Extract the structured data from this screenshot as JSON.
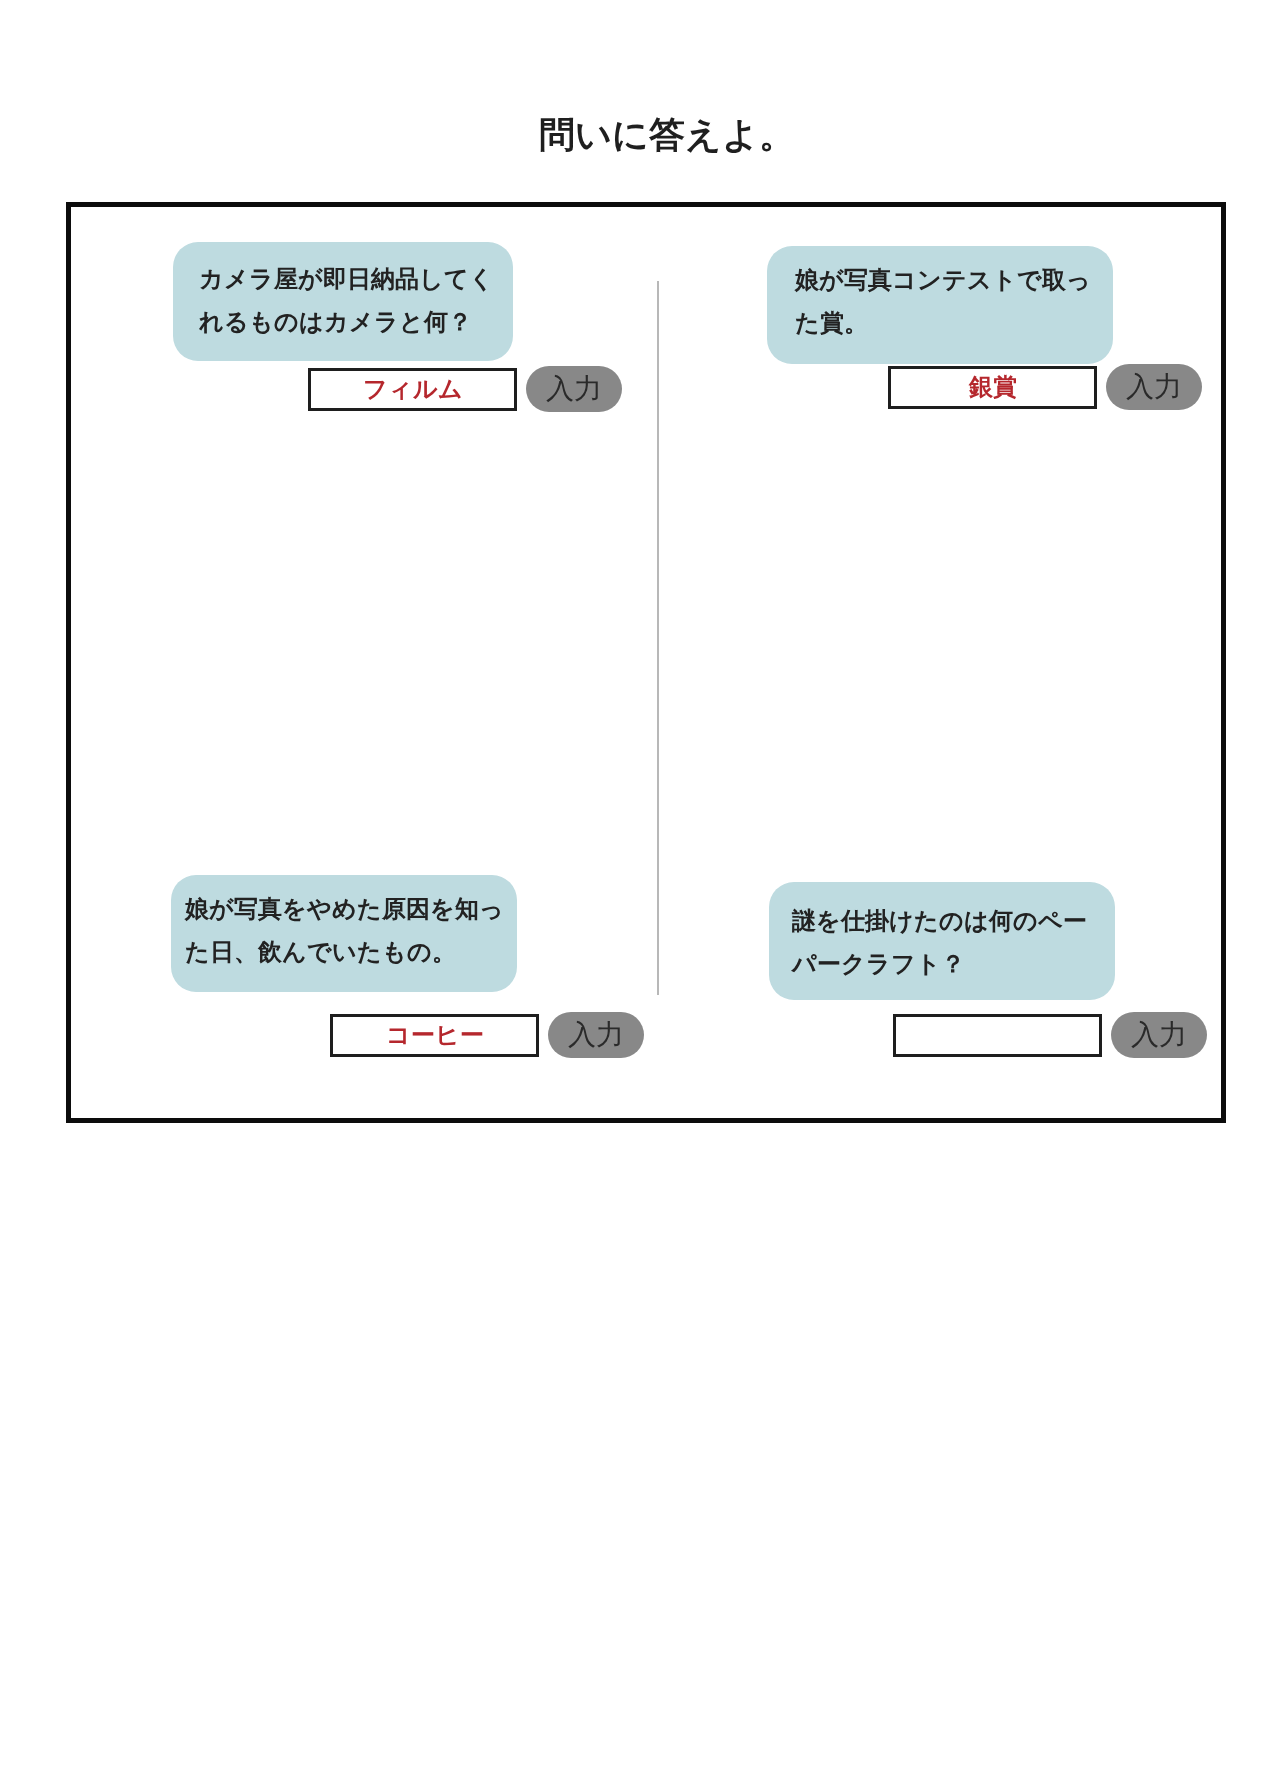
{
  "title": "問いに答えよ。",
  "questions": [
    {
      "question": "カメラ屋が即日納品してくれるものはカメラと何？",
      "answer": "フィルム",
      "button": "入力"
    },
    {
      "question": "娘が写真コンテストで取った賞。",
      "answer": "銀賞",
      "button": "入力"
    },
    {
      "question": "娘が写真をやめた原因を知った日、飲んでいたもの。",
      "answer": "コーヒー",
      "button": "入力"
    },
    {
      "question": "謎を仕掛けたのは何のペーパークラフト？",
      "button": "入力"
    }
  ]
}
